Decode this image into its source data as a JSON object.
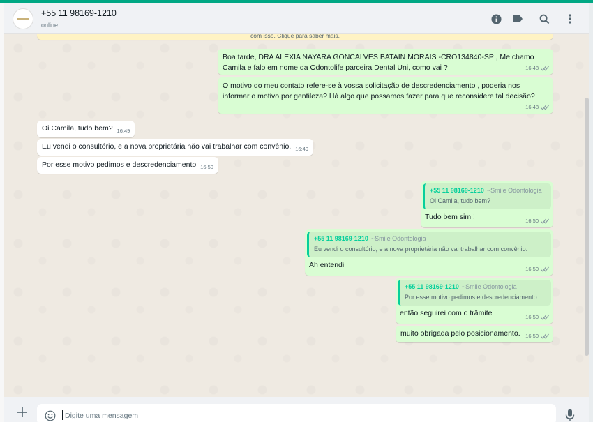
{
  "colors": {
    "accent": "#00a884",
    "outgoing_bubble": "#d9fdd3",
    "incoming_bubble": "#ffffff",
    "chat_bg": "#efeae2",
    "quote_green": "#06cf9c"
  },
  "header": {
    "contact_name": "+55 11 98169-1210",
    "status": "online",
    "icons": [
      "info-icon",
      "label-icon",
      "search-icon",
      "menu-dots-icon"
    ]
  },
  "banner": {
    "text": "com isso. Clique para saber mais."
  },
  "messages": [
    {
      "dir": "out",
      "text": "Boa tarde, DRA ALEXIA NAYARA GONCALVES BATAIN MORAIS -CRO134840-SP , Me chamo Camila e falo em nome da Odontolife parceira Dental Uni, como vai ?",
      "time": "16:48"
    },
    {
      "dir": "out",
      "text": "O motivo do meu contato refere-se à vossa solicitação de descredenciamento , poderia nos informar o motivo por gentileza? Há algo que possamos fazer para que reconsidere tal decisão?",
      "time": "16:48"
    },
    {
      "dir": "in",
      "text": "Oi Camila, tudo bem?",
      "time": "16:49"
    },
    {
      "dir": "in",
      "text": "Eu vendi o consultório, e a nova proprietária não vai trabalhar com convênio.",
      "time": "16:49"
    },
    {
      "dir": "in",
      "text": "Por esse motivo pedimos e descredenciamento",
      "time": "16:50"
    },
    {
      "dir": "out",
      "quote": {
        "number": "+55 11 98169-1210",
        "alias": "~Smile Odontologia",
        "text": "Oi Camila, tudo bem?"
      },
      "text": "Tudo bem sim !",
      "time": "16:50"
    },
    {
      "dir": "out",
      "quote": {
        "number": "+55 11 98169-1210",
        "alias": "~Smile Odontologia",
        "text": "Eu vendi o consultório, e a nova proprietária não vai trabalhar com convênio."
      },
      "text": "Ah entendi",
      "time": "16:50"
    },
    {
      "dir": "out",
      "quote": {
        "number": "+55 11 98169-1210",
        "alias": "~Smile Odontologia",
        "text": "Por esse motivo pedimos e descredenciamento"
      },
      "text": "então seguirei com o trâmite",
      "time": "16:50"
    },
    {
      "dir": "out",
      "text": "muito obrigada pelo posicionamento.",
      "time": "16:50"
    }
  ],
  "composer": {
    "placeholder": "Digite uma mensagem"
  }
}
